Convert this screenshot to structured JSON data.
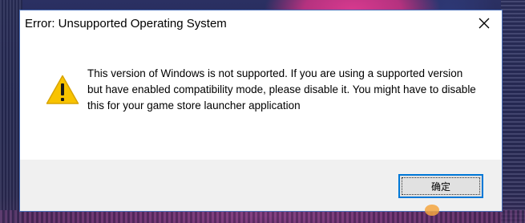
{
  "dialog": {
    "title": "Error: Unsupported Operating System",
    "close_icon": "close-icon",
    "icon": "warning-icon",
    "message": "This version of Windows is not supported. If you are using a supported version but have enabled compatibility mode, please disable it. You might have to disable this for your game store launcher application",
    "ok_label": "确定"
  },
  "colors": {
    "accent": "#0078d7",
    "warning_yellow": "#f8c300",
    "footer_bg": "#f0f0f0"
  }
}
